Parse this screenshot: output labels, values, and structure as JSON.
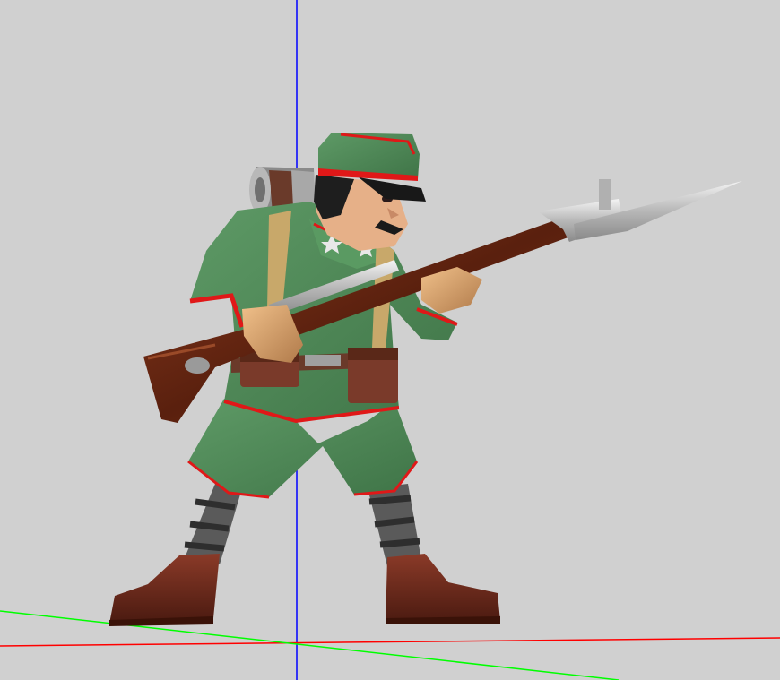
{
  "viewport": {
    "background": "#d0d0d0",
    "axes": {
      "x_color": "#ff0000",
      "y_color": "#0000ff",
      "z_color": "#00ff00"
    },
    "model": {
      "subject": "soldier-with-rifle-and-bayonet",
      "uniform_color": "#4f8a57",
      "trim_color": "#e01818",
      "leather_color": "#7a3a2a",
      "rifle_wood_color": "#6a2a14",
      "steel_color": "#c8c8c8",
      "skin_color": "#d9a070"
    }
  }
}
